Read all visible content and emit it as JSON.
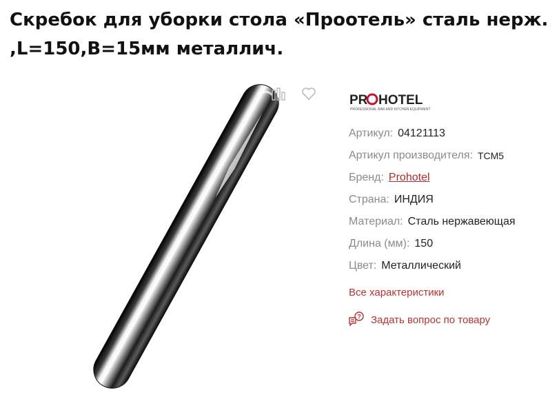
{
  "product": {
    "title": "Скребок для уборки стола «Проотель» сталь нерж. ,L=150,B=15мм металлич."
  },
  "brand_logo": {
    "wordmark_left": "PR",
    "wordmark_right": "HOTEL",
    "tagline": "PROFESSIONAL BAR AND KITCHEN EQUIPMENT",
    "accent_color": "#c8102e"
  },
  "specs": [
    {
      "label": "Артикул:",
      "value": "04121113"
    },
    {
      "label": "Артикул производителя:",
      "value": "TCM5"
    },
    {
      "label": "Бренд:",
      "value": "Prohotel"
    },
    {
      "label": "Страна:",
      "value": "ИНДИЯ"
    },
    {
      "label": "Материал:",
      "value": "Сталь нержавеющая"
    },
    {
      "label": "Длина (мм):",
      "value": "150"
    },
    {
      "label": "Цвет:",
      "value": "Металлический"
    }
  ],
  "links": {
    "all_specs": "Все характеристики",
    "ask_question": "Задать вопрос по товару"
  },
  "icons": {
    "compare": "compare-icon",
    "favorite": "heart-icon",
    "ask": "chat-question-icon"
  },
  "colors": {
    "link": "#b83232",
    "label": "#8a8a8a"
  }
}
